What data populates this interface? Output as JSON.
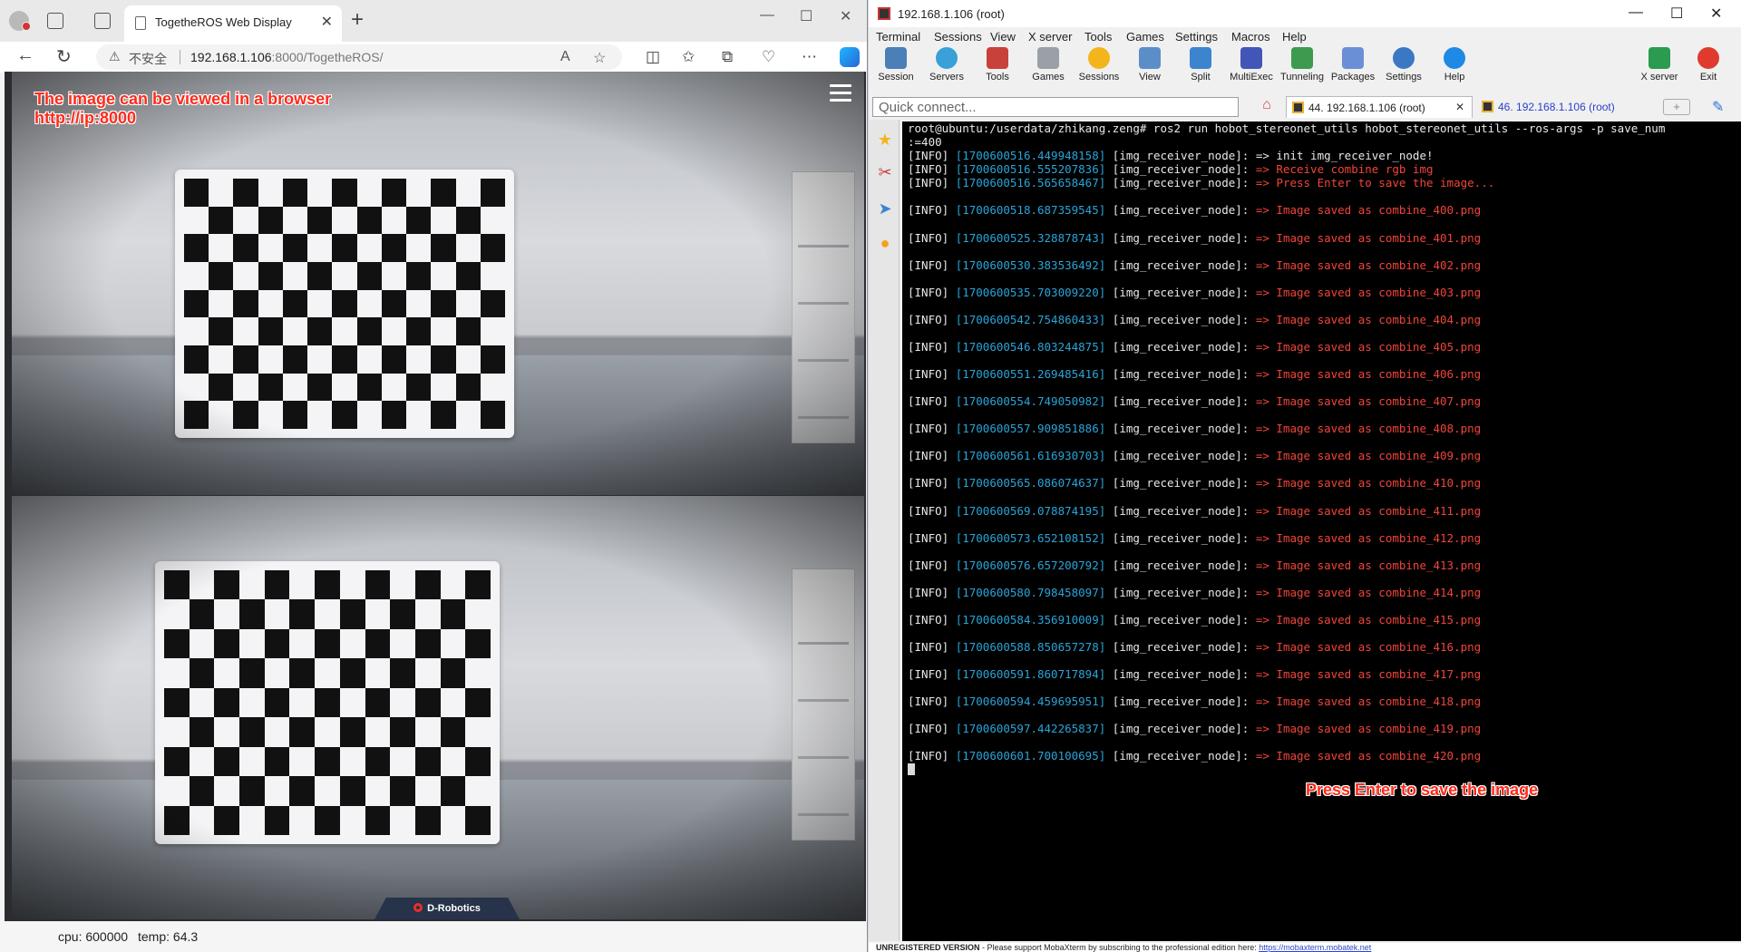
{
  "browser": {
    "tab_title": "TogetheROS Web Display",
    "insecure_label": "不安全",
    "url_host": "192.168.1.106",
    "url_rest": ":8000/TogetheROS/",
    "overlay_line1": "The image can be viewed in a browser",
    "overlay_line2": "http://ip:8000",
    "brand": "D-Robotics",
    "status_cpu": "cpu: 600000",
    "status_temp": "temp: 64.3"
  },
  "moba": {
    "window_title": "192.168.1.106 (root)",
    "menu": [
      "Terminal",
      "Sessions",
      "View",
      "X server",
      "Tools",
      "Games",
      "Settings",
      "Macros",
      "Help"
    ],
    "toolbar": [
      "Session",
      "Servers",
      "Tools",
      "Games",
      "Sessions",
      "View",
      "Split",
      "MultiExec",
      "Tunneling",
      "Packages",
      "Settings",
      "Help",
      "X server",
      "Exit"
    ],
    "quick_connect_placeholder": "Quick connect...",
    "tab_active": "44. 192.168.1.106 (root)",
    "tab_inactive": "46. 192.168.1.106 (root)",
    "status_bold": "UNREGISTERED VERSION",
    "status_text": " - Please support MobaXterm by subscribing to the professional edition here: ",
    "status_link": "https://mobaxterm.mobatek.net"
  },
  "terminal": {
    "prompt_line1": "root@ubuntu:/userdata/zhikang.zeng# ros2 run hobot_stereonet_utils hobot_stereonet_utils --ros-args -p save_num",
    "prompt_line2": ":=400",
    "header_lines": [
      {
        "level": "[INFO]",
        "ts": "[1700600516.449948158]",
        "node": "[img_receiver_node]: ",
        "msg": "=> init img_receiver_node!",
        "msg_color": "#e8e8e8"
      },
      {
        "level": "[INFO]",
        "ts": "[1700600516.555207836]",
        "node": "[img_receiver_node]: ",
        "msg": "=> Receive combine rgb img",
        "msg_color": "#f0453a"
      },
      {
        "level": "[INFO]",
        "ts": "[1700600516.565658467]",
        "node": "[img_receiver_node]: ",
        "msg": "=> Press Enter to save the image...",
        "msg_color": "#f0453a"
      }
    ],
    "saved_lines": [
      {
        "ts": "[1700600518.687359545]",
        "msg": "=> Image saved as combine_400.png"
      },
      {
        "ts": "[1700600525.328878743]",
        "msg": "=> Image saved as combine_401.png"
      },
      {
        "ts": "[1700600530.383536492]",
        "msg": "=> Image saved as combine_402.png"
      },
      {
        "ts": "[1700600535.703009220]",
        "msg": "=> Image saved as combine_403.png"
      },
      {
        "ts": "[1700600542.754860433]",
        "msg": "=> Image saved as combine_404.png"
      },
      {
        "ts": "[1700600546.803244875]",
        "msg": "=> Image saved as combine_405.png"
      },
      {
        "ts": "[1700600551.269485416]",
        "msg": "=> Image saved as combine_406.png"
      },
      {
        "ts": "[1700600554.749050982]",
        "msg": "=> Image saved as combine_407.png"
      },
      {
        "ts": "[1700600557.909851886]",
        "msg": "=> Image saved as combine_408.png"
      },
      {
        "ts": "[1700600561.616930703]",
        "msg": "=> Image saved as combine_409.png"
      },
      {
        "ts": "[1700600565.086074637]",
        "msg": "=> Image saved as combine_410.png"
      },
      {
        "ts": "[1700600569.078874195]",
        "msg": "=> Image saved as combine_411.png"
      },
      {
        "ts": "[1700600573.652108152]",
        "msg": "=> Image saved as combine_412.png"
      },
      {
        "ts": "[1700600576.657200792]",
        "msg": "=> Image saved as combine_413.png"
      },
      {
        "ts": "[1700600580.798458097]",
        "msg": "=> Image saved as combine_414.png"
      },
      {
        "ts": "[1700600584.356910009]",
        "msg": "=> Image saved as combine_415.png"
      },
      {
        "ts": "[1700600588.850657278]",
        "msg": "=> Image saved as combine_416.png"
      },
      {
        "ts": "[1700600591.860717894]",
        "msg": "=> Image saved as combine_417.png"
      },
      {
        "ts": "[1700600594.459695951]",
        "msg": "=> Image saved as combine_418.png"
      },
      {
        "ts": "[1700600597.442265837]",
        "msg": "=> Image saved as combine_419.png"
      },
      {
        "ts": "[1700600601.700100695]",
        "msg": "=> Image saved as combine_420.png"
      }
    ],
    "level_label": "[INFO]",
    "node_label": "[img_receiver_node]: ",
    "annotation": "Press Enter to save the image"
  }
}
